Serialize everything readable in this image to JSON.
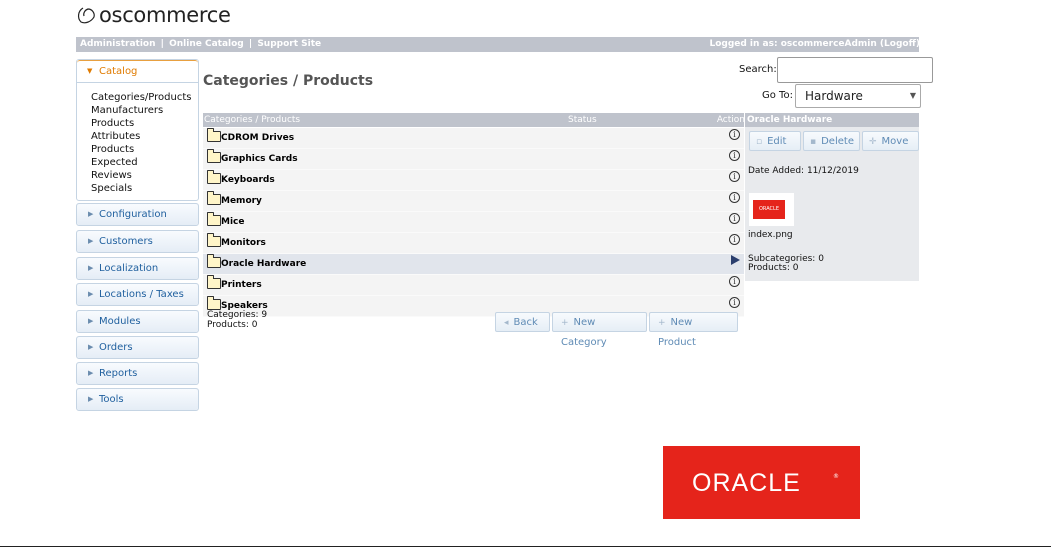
{
  "brand": {
    "logo_text": "oscommerce"
  },
  "header": {
    "links": [
      "Administration",
      "Online Catalog",
      "Support Site"
    ],
    "separator": "|",
    "logged_in": "Logged in as: oscommerceAdmin (Logoff)"
  },
  "sidebar": {
    "catalog": {
      "label": "Catalog",
      "items": [
        "Categories/Products",
        "Manufacturers",
        "Products",
        "Attributes",
        "Products",
        "Expected",
        "Reviews",
        "Specials"
      ]
    },
    "sections": [
      "Configuration",
      "Customers",
      "Localization",
      "Locations / Taxes",
      "Modules",
      "Orders",
      "Reports",
      "Tools"
    ]
  },
  "main": {
    "title": "Categories / Products",
    "search_label": "Search:",
    "search_value": "",
    "goto_label": "Go To:",
    "goto_value": "Hardware",
    "table": {
      "headers": [
        "Categories / Products",
        "Status",
        "Action"
      ],
      "rows": [
        "CDROM Drives",
        "Graphics Cards",
        "Keyboards",
        "Memory",
        "Mice",
        "Monitors",
        "Oracle Hardware",
        "Printers",
        "Speakers"
      ],
      "selected": "Oracle Hardware",
      "info_icon": "info-icon",
      "select_icon": "right-arrow-icon"
    },
    "categories_count": "Categories: 9",
    "products_count": "Products: 0",
    "buttons": {
      "back": "Back",
      "new_category": "New Category",
      "new_product": "New Product"
    }
  },
  "panel": {
    "title": "Oracle Hardware",
    "buttons": {
      "edit": "Edit",
      "delete": "Delete",
      "move": "Move"
    },
    "date_added": "Date Added: 11/12/2019",
    "thumb_text": "ORACLE",
    "image_name": "index.png",
    "subcategories": "Subcategories: 0",
    "products": "Products: 0"
  },
  "footer_logo": {
    "text": "ORACLE",
    "mark": "®"
  },
  "colors": {
    "accent": "#e07b00",
    "oracle_red": "#e5241b",
    "header_gray": "#bfc3cc",
    "link_blue": "#1f5f9e"
  }
}
